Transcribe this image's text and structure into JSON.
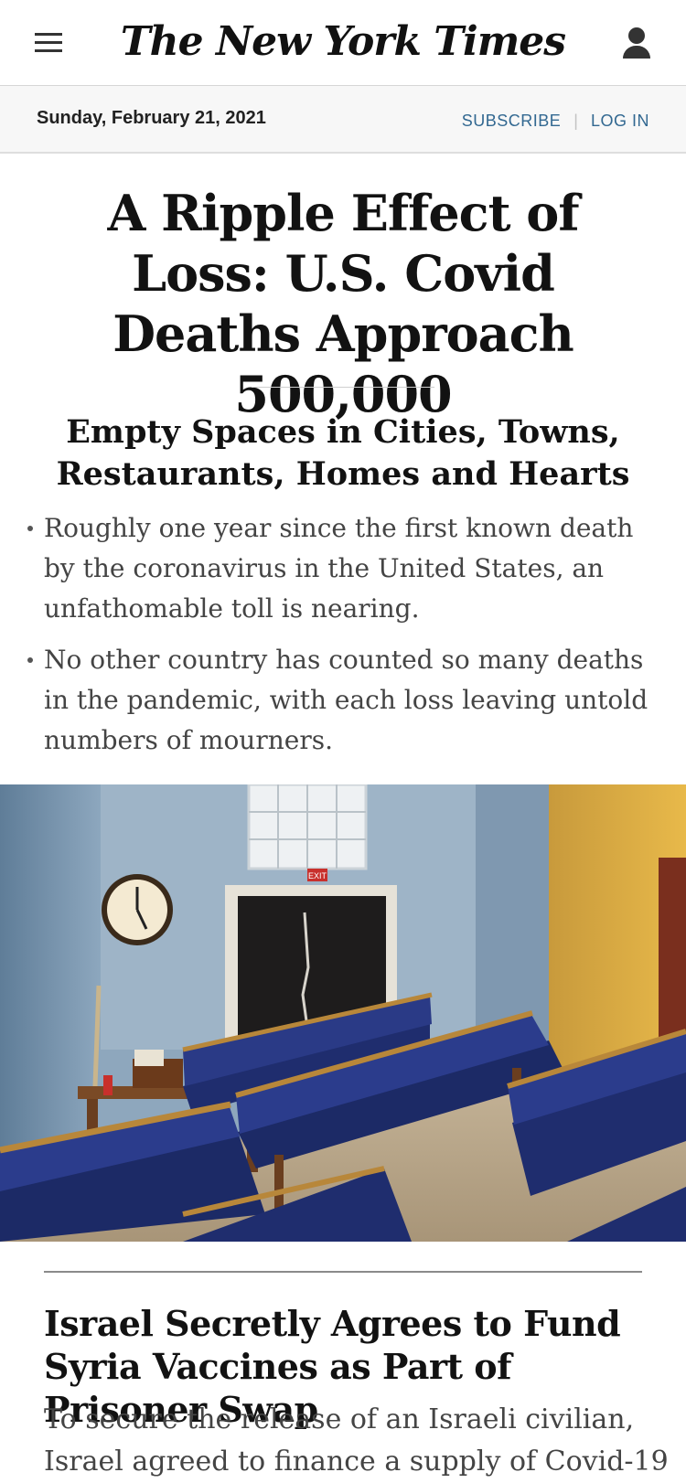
{
  "header": {
    "logo_text": "The New York Times",
    "menu_icon": "hamburger-menu-icon",
    "account_icon": "account-person-icon"
  },
  "datebar": {
    "date": "Sunday, February 21, 2021",
    "subscribe_label": "SUBSCRIBE",
    "separator": "|",
    "login_label": "LOG IN",
    "link_color": "#326891"
  },
  "lead_story": {
    "headline": "A Ripple Effect of Loss: U.S. Covid Deaths Approach 500,000",
    "subheadline": "Empty Spaces in Cities, Towns, Restaurants, Homes and Hearts",
    "bullets": [
      "Roughly one year since the first known death by the coronavirus in the United States, an unfathomable toll is nearing.",
      "No other country has counted so many deaths in the pandemic, with each loss leaving untold numbers of mourners."
    ],
    "photo_sign_text": "EXIT"
  },
  "second_story": {
    "headline": "Israel Secretly Agrees to Fund Syria Vaccines as Part of Prisoner Swap",
    "summary": "To secure the release of an Israeli civilian, Israel agreed to finance a supply of Covid-19"
  }
}
